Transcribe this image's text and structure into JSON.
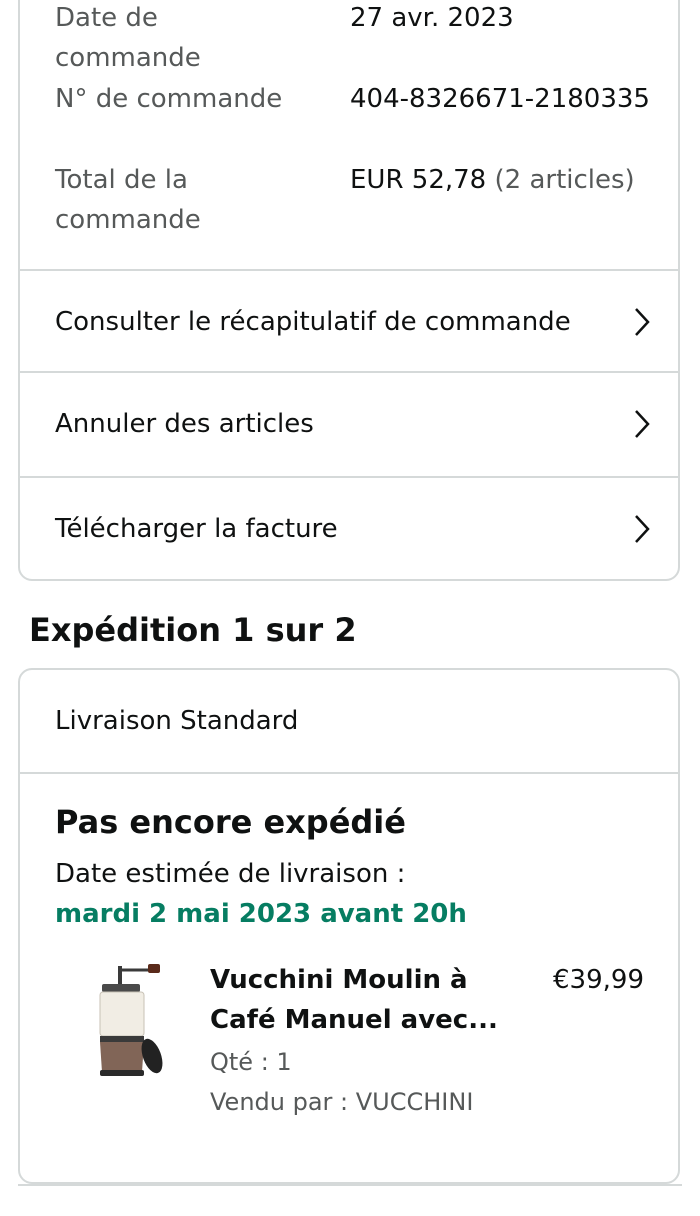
{
  "order_info": {
    "date_label": "Date de commande",
    "date_value": "27 avr. 2023",
    "number_label": "N° de commande",
    "number_value": "404-8326671-2180335",
    "total_label": "Total de la commande",
    "total_value": "EUR 52,78",
    "total_items": "(2 articles)"
  },
  "actions": {
    "summary": "Consulter le récapitulatif de commande",
    "cancel": "Annuler des articles",
    "invoice": "Télécharger la facture"
  },
  "shipment": {
    "title": "Expédition 1 sur 2",
    "method": "Livraison Standard",
    "status": "Pas encore expédié",
    "eta_label": "Date estimée de livraison :",
    "eta_date": "mardi 2 mai 2023 avant 20h",
    "eta_color": "#067d62",
    "item": {
      "title": "Vucchini Moulin à Café Manuel avec...",
      "price": "€39,99",
      "qty": "Qté : 1",
      "seller": "Vendu par : VUCCHINI",
      "image_icon": "coffee-grinder-image"
    }
  }
}
